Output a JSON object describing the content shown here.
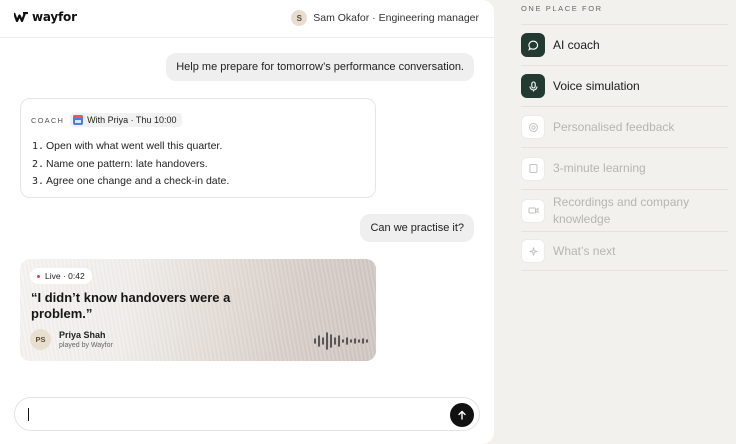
{
  "brand": {
    "name": "wayfor"
  },
  "user": {
    "initial": "S",
    "label": "Sam Okafor · Engineering manager"
  },
  "messages": {
    "user_1": "Help me prepare for tomorrow’s performance conversation.",
    "user_2": "Can we practise it?"
  },
  "coach_card": {
    "label": "COACH",
    "meeting": "With Priya · Thu 10:00",
    "steps": [
      {
        "num": "1.",
        "text": "Open with what went well this quarter."
      },
      {
        "num": "2.",
        "text": "Name one pattern: late handovers."
      },
      {
        "num": "3.",
        "text": "Agree one change and a check-in date."
      }
    ]
  },
  "voice_card": {
    "status": "Live · 0:42",
    "quote": "“I didn’t know handovers were a problem.”",
    "persona_initials": "PS",
    "persona_name": "Priya Shah",
    "persona_sub": "played by Wayfor"
  },
  "composer": {
    "value": ""
  },
  "panel": {
    "title": "ONE PLACE FOR",
    "features": [
      {
        "label": "AI coach",
        "icon": "chat-bubble-icon",
        "active": true
      },
      {
        "label": "Voice simulation",
        "icon": "microphone-icon",
        "active": true
      },
      {
        "label": "Personalised feedback",
        "icon": "target-icon",
        "active": false
      },
      {
        "label": "3-minute learning",
        "icon": "card-icon",
        "active": false
      },
      {
        "label": "Recordings and company knowledge",
        "icon": "video-icon",
        "active": false
      },
      {
        "label": "What’s next",
        "icon": "sparkle-icon",
        "active": false
      }
    ]
  },
  "colors": {
    "accent": "#233a32",
    "send": "#111111",
    "live": "#dd4444"
  }
}
